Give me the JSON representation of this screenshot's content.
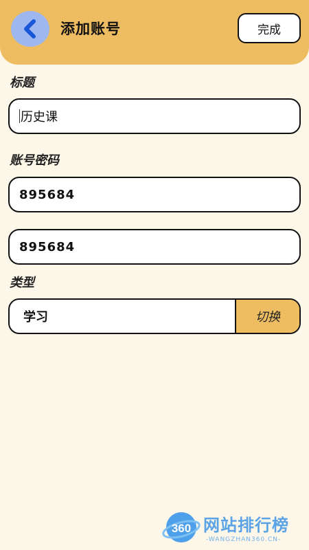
{
  "header": {
    "title": "添加账号",
    "done_label": "完成",
    "back_icon": "chevron-left-icon",
    "colors": {
      "header_bg": "#eebd62",
      "back_bg": "#9fb7ef"
    }
  },
  "form": {
    "title_label": "标题",
    "title_value": "历史课",
    "account_label": "账号密码",
    "account_value": "895684",
    "password_value": "895684",
    "type_label": "类型",
    "type_value": "学习",
    "switch_label": "切换"
  },
  "watermark": {
    "logo_text": "360",
    "brand": "网站排行榜",
    "url": "-WANGZHAN360.CN-"
  }
}
